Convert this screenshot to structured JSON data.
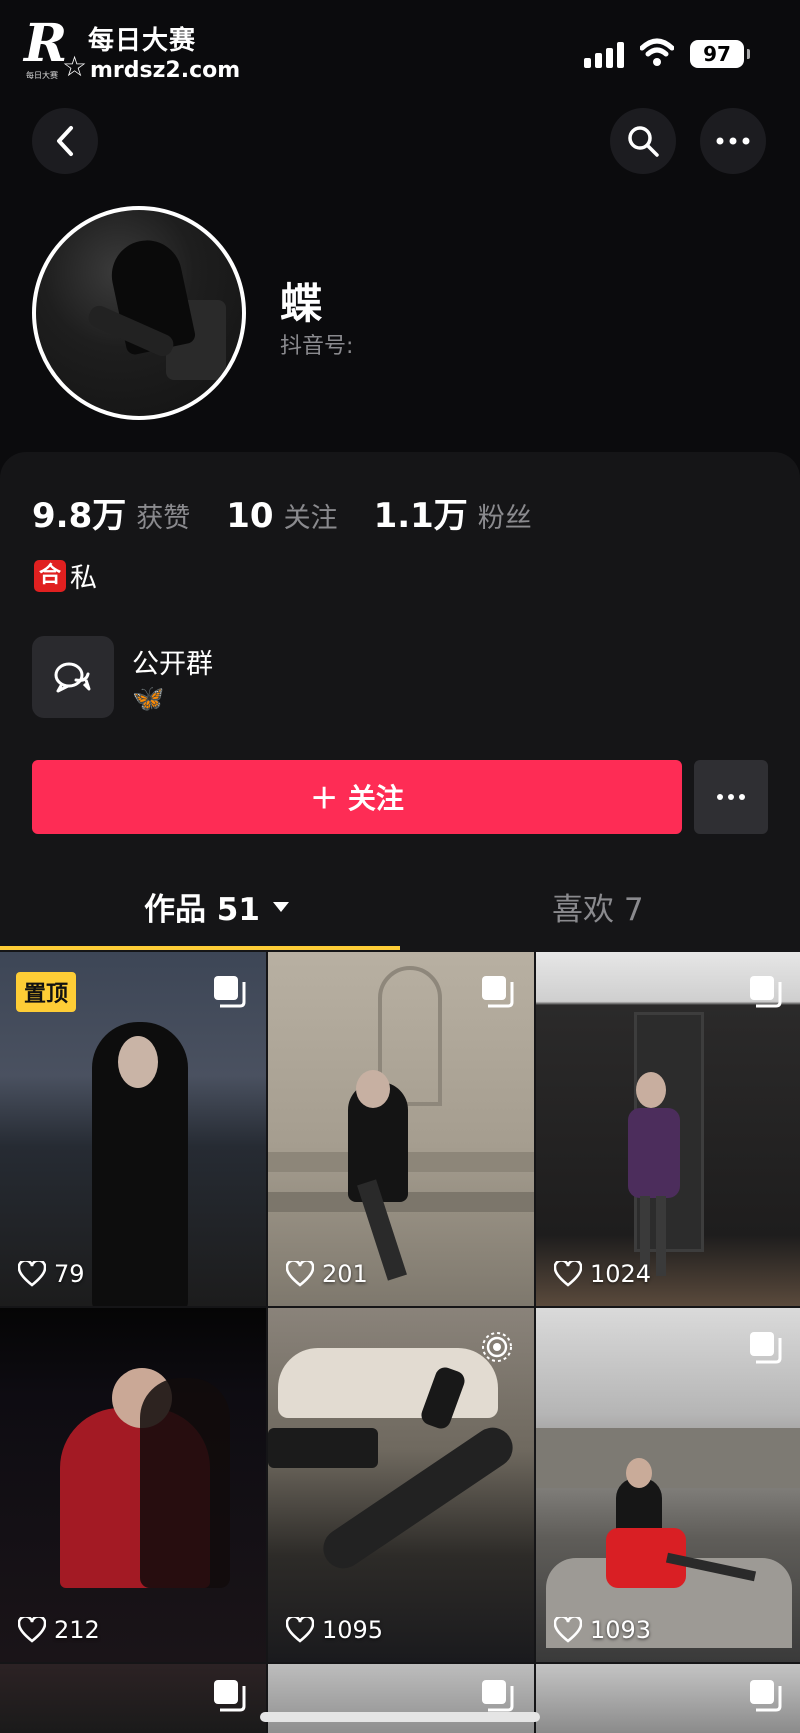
{
  "status": {
    "watermark_cn": "每日大赛",
    "watermark_url": "mrdsz2.com",
    "watermark_small": "每日大赛",
    "battery": "97"
  },
  "profile": {
    "name": "蝶",
    "douyin_id_label": "抖音号:"
  },
  "stats": [
    {
      "value": "9.8万",
      "label": "获赞"
    },
    {
      "value": "10",
      "label": "关注"
    },
    {
      "value": "1.1万",
      "label": "粉丝"
    }
  ],
  "tagline": {
    "emoji": "合",
    "text": "私"
  },
  "group": {
    "name": "公开群",
    "sub": "🦋"
  },
  "actions": {
    "follow_label": "＋ 关注"
  },
  "tabs": {
    "works_label": "作品 51",
    "likes_label": "喜欢 7"
  },
  "grid": {
    "pin_label": "置顶",
    "items": [
      {
        "likes": "79"
      },
      {
        "likes": "201"
      },
      {
        "likes": "1024"
      },
      {
        "likes": "212"
      },
      {
        "likes": "1095"
      },
      {
        "likes": "1093"
      }
    ]
  },
  "colors": {
    "accent": "#fe2c55",
    "tab_indicator": "#fecd36",
    "background": "#0b0b0d"
  }
}
